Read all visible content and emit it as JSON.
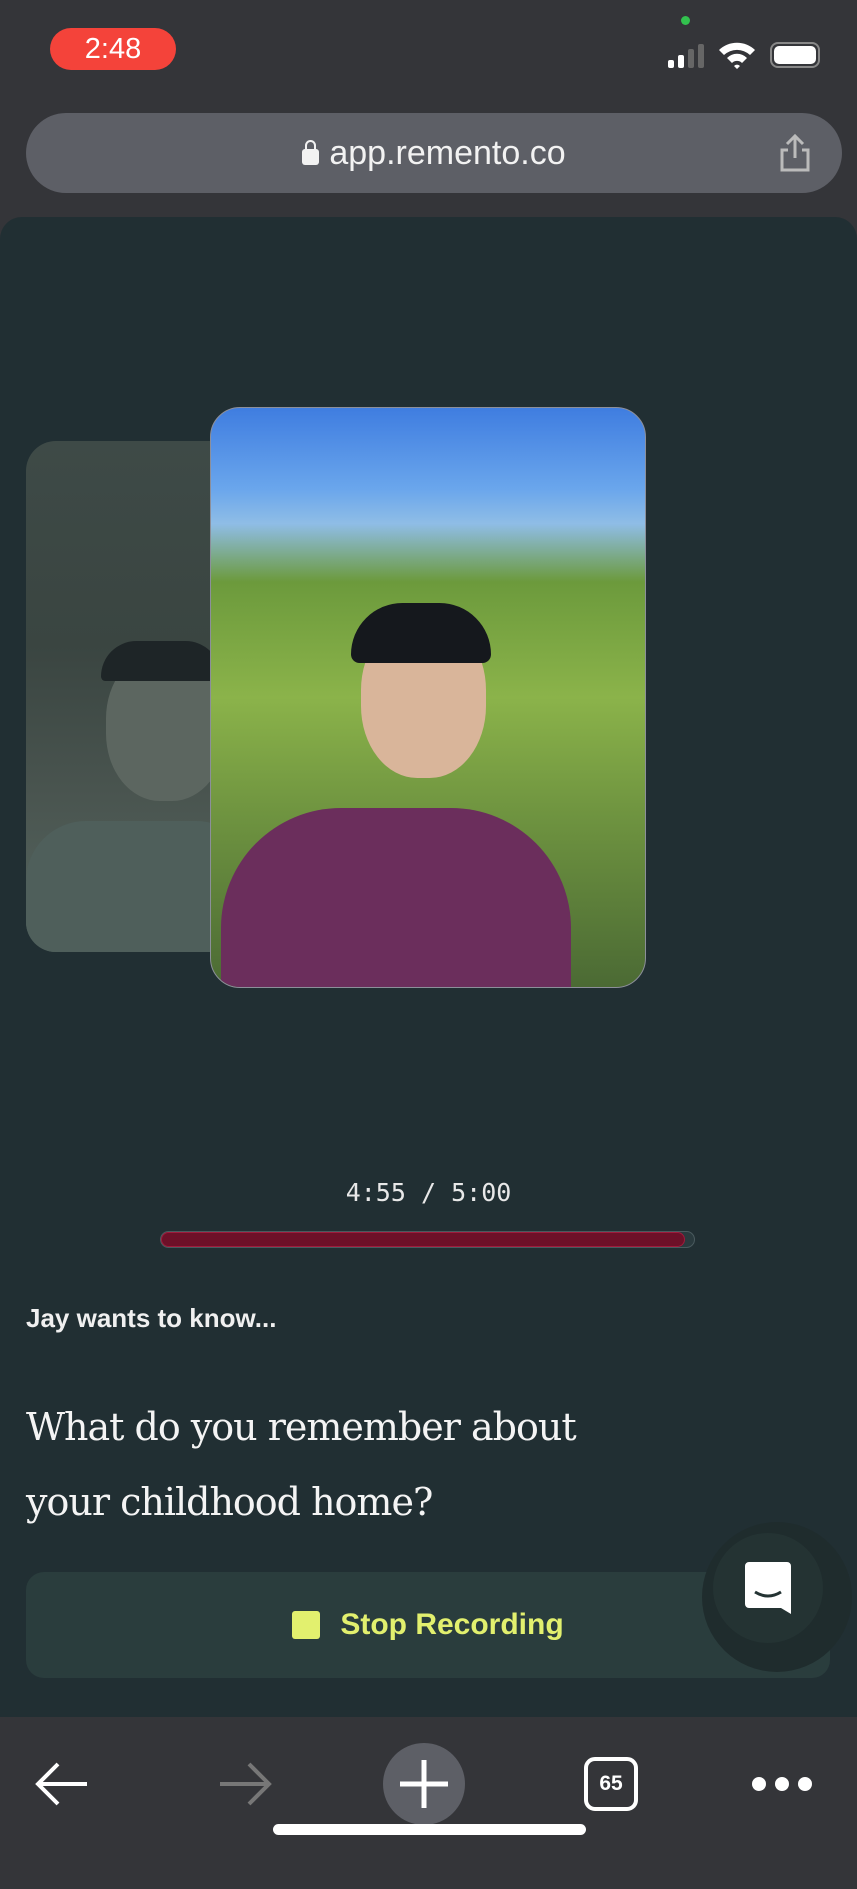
{
  "status_bar": {
    "time": "2:48",
    "icons": [
      "signal-icon",
      "wifi-icon",
      "battery-icon"
    ],
    "camera_indicator_color": "#32c14e"
  },
  "browser": {
    "url": "app.remento.co",
    "lock_icon": "lock-icon",
    "share_icon": "share-icon"
  },
  "recording": {
    "elapsed": "4:55",
    "total": "5:00",
    "separator": "/",
    "progress_fraction": 0.983,
    "progress_color": "#6d1028"
  },
  "prompt": {
    "label": "Jay wants to know...",
    "question_line1": "What do you remember about",
    "question_line2": "your childhood home?"
  },
  "stop_button": {
    "label": "Stop Recording",
    "color": "#e2f06e"
  },
  "chat_button": {
    "icon": "chat-icon"
  },
  "toolbar": {
    "tab_count": "65",
    "icons": [
      "back-arrow-icon",
      "forward-arrow-icon",
      "new-tab-icon",
      "tabs-icon",
      "more-icon"
    ]
  }
}
